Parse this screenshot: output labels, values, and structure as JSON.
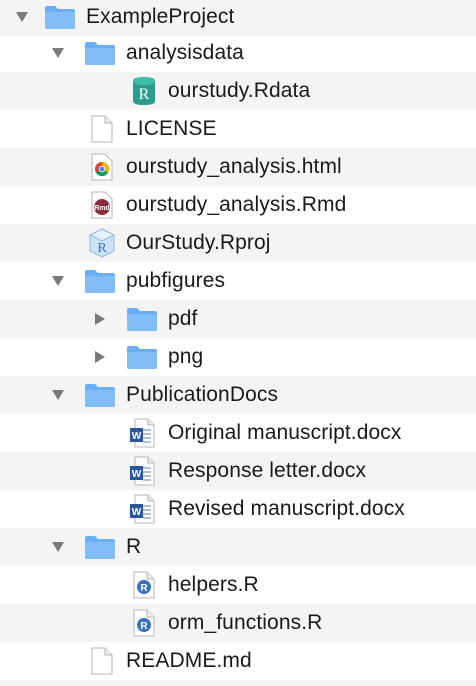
{
  "window": {
    "title": "ExampleProject"
  },
  "icons": {
    "folder": "folder-icon",
    "rdata": "r-data-icon",
    "file": "document-icon",
    "chrome": "chrome-icon",
    "rmd": "rmarkdown-icon",
    "rproj": "r-project-icon",
    "word": "word-document-icon",
    "rscript": "r-script-icon"
  },
  "colors": {
    "folder_blue": "#6aaef5",
    "row_alt": "#f4f4f4",
    "r_blue": "#3b6fc6",
    "word_blue": "#2b579a",
    "rdata_teal": "#2a9d8a",
    "rmd_red": "#8b2c3a"
  },
  "tree": {
    "root": {
      "label": "ExampleProject",
      "expanded": true
    },
    "analysisdata": {
      "label": "analysisdata",
      "expanded": true
    },
    "ourstudy_rdata": {
      "label": "ourstudy.Rdata",
      "icon_letter": "R"
    },
    "license": {
      "label": "LICENSE"
    },
    "analysis_html": {
      "label": "ourstudy_analysis.html"
    },
    "analysis_rmd": {
      "label": "ourstudy_analysis.Rmd",
      "icon_text": "Rmd"
    },
    "rproj": {
      "label": "OurStudy.Rproj",
      "icon_letter": "R"
    },
    "pubfigures": {
      "label": "pubfigures",
      "expanded": true
    },
    "pdf": {
      "label": "pdf",
      "expanded": false
    },
    "png": {
      "label": "png",
      "expanded": false
    },
    "publicationdocs": {
      "label": "PublicationDocs",
      "expanded": true
    },
    "original_manuscript": {
      "label": "Original manuscript.docx",
      "icon_letter": "W"
    },
    "response_letter": {
      "label": "Response letter.docx",
      "icon_letter": "W"
    },
    "revised_manuscript": {
      "label": "Revised manuscript.docx",
      "icon_letter": "W"
    },
    "r_folder": {
      "label": "R",
      "expanded": true
    },
    "helpers": {
      "label": "helpers.R",
      "icon_letter": "R"
    },
    "orm_functions": {
      "label": "orm_functions.R",
      "icon_letter": "R"
    },
    "readme": {
      "label": "README.md"
    }
  }
}
